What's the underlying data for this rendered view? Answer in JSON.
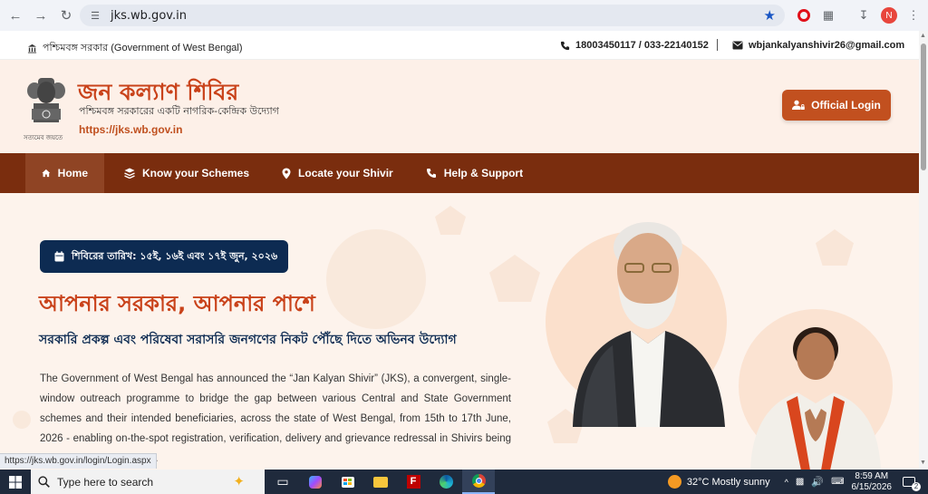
{
  "browser": {
    "url": "jks.wb.gov.in",
    "profile_initial": "N"
  },
  "topstrip": {
    "government": "পশ্চিমবঙ্গ সরকার (Government of West Bengal)",
    "phone": "18003450117 / 033-22140152",
    "email": "wbjankalyanshivir26@gmail.com"
  },
  "header": {
    "title": "জন কল্যাণ শিবির",
    "subtitle": "পশ্চিমবঙ্গ সরকারের একটি নাগরিক-কেন্দ্রিক উদ্যোগ",
    "url": "https://jks.wb.gov.in",
    "emblem_motto": "সত্যমেব জয়তে",
    "login_label": "Official Login"
  },
  "nav": {
    "items": [
      {
        "label": "Home",
        "icon": "home-icon"
      },
      {
        "label": "Know your Schemes",
        "icon": "layers-icon"
      },
      {
        "label": "Locate your Shivir",
        "icon": "location-pin-icon"
      },
      {
        "label": "Help & Support",
        "icon": "phone-icon"
      }
    ]
  },
  "hero": {
    "date_badge": "শিবিরের তারিখ: ১৫ই, ১৬ই এবং ১৭ই জুন, ২০২৬",
    "headline": "আপনার সরকার, আপনার পাশে",
    "subheadline": "সরকারি প্রকল্প এবং পরিষেবা সরাসরি জনগণের নিকট পৌঁছে দিতে অভিনব উদ্যোগ",
    "body": "The Government of West Bengal has announced the “Jan Kalyan Shivir” (JKS), a convergent, single-window outreach programme to bridge the gap between various Central and State Government schemes and their intended beneficiaries, across the state of West Bengal, from 15th to 17th June, 2026 - enabling on-the-spot registration, verification, delivery and grievance redressal in Shivirs being held throughout the state."
  },
  "status_bar": {
    "link_url": "https://jks.wb.gov.in/login/Login.aspx"
  },
  "taskbar": {
    "search_placeholder": "Type here to search",
    "weather": "32°C  Mostly sunny",
    "time": "8:59 AM",
    "date": "6/15/2026",
    "notifications": "2"
  },
  "colors": {
    "brand_orange": "#c9421a",
    "nav_brown": "#7a2d0e",
    "navy": "#0d2b52",
    "login_button": "#c2501f"
  }
}
